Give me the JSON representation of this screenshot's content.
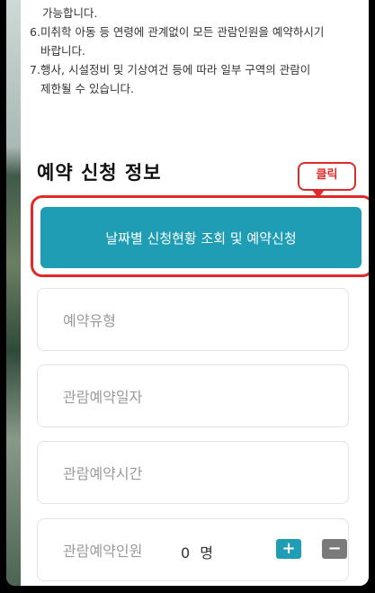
{
  "notice": {
    "line_top": "가능합니다.",
    "items": [
      {
        "num": "6.",
        "line1": "미취학 아동 등 연령에 관계없이 모든 관람인원을 예약하시기",
        "line2": "바랍니다."
      },
      {
        "num": "7.",
        "line1": "행사, 시설정비 및 기상여건 등에 따라 일부 구역의 관람이",
        "line2": "제한될 수 있습니다."
      }
    ]
  },
  "section_title": "예약 신청 정보",
  "callout_label": "클릭",
  "primary_button_label": "날짜별 신청현황 조회 및 예약신청",
  "fields": {
    "reservation_type": "예약유형",
    "visit_date": "관람예약일자",
    "visit_time": "관람예약시간",
    "visitor_count_label": "관람예약인원"
  },
  "visitor_count": {
    "value": "0",
    "unit": "명"
  },
  "stepper": {
    "plus": "+",
    "minus": "−"
  },
  "colors": {
    "accent": "#1f9db5",
    "highlight": "#e02a2a"
  }
}
